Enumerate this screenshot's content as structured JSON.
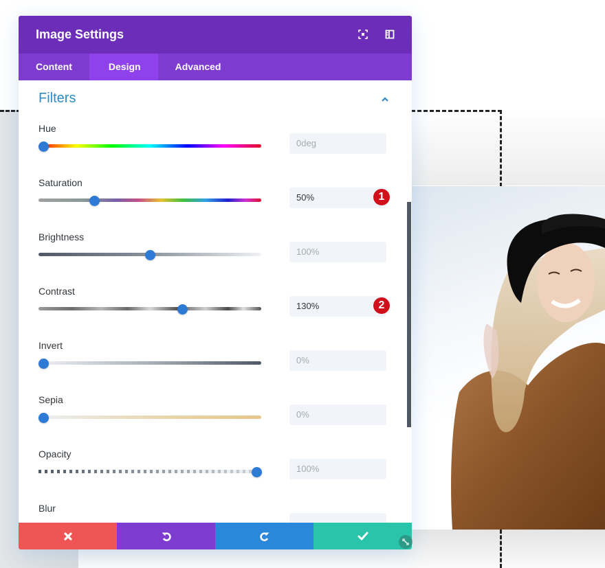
{
  "modal": {
    "title": "Image Settings",
    "header_icons": [
      "expand-icon",
      "sidebar-toggle-icon"
    ],
    "tabs": [
      {
        "label": "Content",
        "active": false
      },
      {
        "label": "Design",
        "active": true
      },
      {
        "label": "Advanced",
        "active": false
      }
    ],
    "section": {
      "title": "Filters",
      "expanded": true
    },
    "filters": [
      {
        "label": "Hue",
        "value": "0deg",
        "position": 0.0,
        "changed": false,
        "badge": null
      },
      {
        "label": "Saturation",
        "value": "50%",
        "position": 0.25,
        "changed": true,
        "badge": "1"
      },
      {
        "label": "Brightness",
        "value": "100%",
        "position": 0.5,
        "changed": false,
        "badge": null
      },
      {
        "label": "Contrast",
        "value": "130%",
        "position": 0.645,
        "changed": true,
        "badge": "2"
      },
      {
        "label": "Invert",
        "value": "0%",
        "position": 0.0,
        "changed": false,
        "badge": null
      },
      {
        "label": "Sepia",
        "value": "0%",
        "position": 0.0,
        "changed": false,
        "badge": null
      },
      {
        "label": "Opacity",
        "value": "100%",
        "position": 1.0,
        "changed": false,
        "badge": null
      },
      {
        "label": "Blur",
        "value": "",
        "position": 0.0,
        "changed": false,
        "badge": null
      }
    ],
    "footer": {
      "cancel_icon": "close-icon",
      "undo_icon": "undo-icon",
      "redo_icon": "redo-icon",
      "save_icon": "check-icon"
    }
  },
  "colors": {
    "header": "#6c2eb9",
    "tabs_bar": "#7d3bcf",
    "tab_active": "#8f42ec",
    "section_title": "#2e8bc8",
    "slider_thumb": "#2e7bd6",
    "badge": "#d0101a",
    "cancel": "#ef5555",
    "undo": "#7e3bd0",
    "redo": "#2b87da",
    "save": "#29c4a9"
  }
}
